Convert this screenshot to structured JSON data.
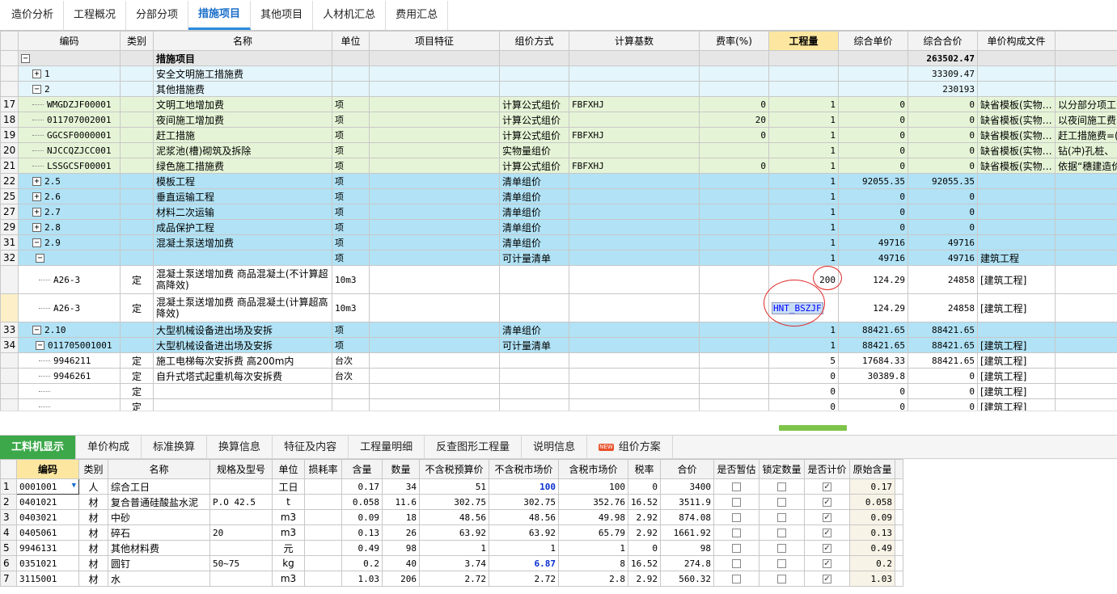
{
  "top_tabs": [
    "造价分析",
    "工程概况",
    "分部分项",
    "措施项目",
    "其他项目",
    "人材机汇总",
    "费用汇总"
  ],
  "grid": {
    "headers": [
      "",
      "编码",
      "类别",
      "名称",
      "单位",
      "项目特征",
      "组价方式",
      "计算基数",
      "费率(%)",
      "工程量",
      "综合单价",
      "综合合价",
      "单价构成文件"
    ],
    "rows": [
      {
        "seq": "",
        "tog": "−",
        "code": "",
        "type": "",
        "name": "措施项目",
        "unit": "",
        "feat": "",
        "method": "",
        "base": "",
        "rate": "",
        "qty": "",
        "uprice": "",
        "total": "263502.47",
        "file": "",
        "style": "gray",
        "indent": 0,
        "bold": true
      },
      {
        "seq": "",
        "tog": "+",
        "code": "1",
        "type": "",
        "name": "安全文明施工措施费",
        "unit": "",
        "feat": "",
        "method": "",
        "base": "",
        "rate": "",
        "qty": "",
        "uprice": "",
        "total": "33309.47",
        "file": "",
        "style": "lb",
        "indent": 1
      },
      {
        "seq": "",
        "tog": "−",
        "code": "2",
        "type": "",
        "name": "其他措施费",
        "unit": "",
        "feat": "",
        "method": "",
        "base": "",
        "rate": "",
        "qty": "",
        "uprice": "",
        "total": "230193",
        "file": "",
        "style": "lb",
        "indent": 1
      },
      {
        "seq": "17",
        "tog": "",
        "code": "WMGDZJF00001",
        "type": "",
        "name": "文明工地增加费",
        "unit": "项",
        "feat": "",
        "method": "计算公式组价",
        "base": "FBFXHJ",
        "rate": "0",
        "qty": "1",
        "uprice": "0",
        "total": "0",
        "file": "缺省模板(实物…",
        "extra": "以分部分项工",
        "style": "green",
        "indent": 2
      },
      {
        "seq": "18",
        "tog": "",
        "code": "011707002001",
        "type": "",
        "name": "夜间施工增加费",
        "unit": "项",
        "feat": "",
        "method": "计算公式组价",
        "base": "",
        "rate": "20",
        "qty": "1",
        "uprice": "0",
        "total": "0",
        "file": "缺省模板(实物…",
        "extra": "以夜间施工费",
        "style": "green",
        "indent": 2
      },
      {
        "seq": "19",
        "tog": "",
        "code": "GGCSF0000001",
        "type": "",
        "name": "赶工措施",
        "unit": "项",
        "feat": "",
        "method": "计算公式组价",
        "base": "FBFXHJ",
        "rate": "0",
        "qty": "1",
        "uprice": "0",
        "total": "0",
        "file": "缺省模板(实物…",
        "extra": "赶工措施费=(",
        "style": "green",
        "indent": 2
      },
      {
        "seq": "20",
        "tog": "",
        "code": "NJCCQZJCC001",
        "type": "",
        "name": "泥浆池(槽)砌筑及拆除",
        "unit": "项",
        "feat": "",
        "method": "实物量组价",
        "base": "",
        "rate": "",
        "qty": "1",
        "uprice": "0",
        "total": "0",
        "file": "缺省模板(实物…",
        "extra": "钻(冲)孔桩、",
        "style": "green",
        "indent": 2
      },
      {
        "seq": "21",
        "tog": "",
        "code": "LSSGCSF00001",
        "type": "",
        "name": "绿色施工措施费",
        "unit": "项",
        "feat": "",
        "method": "计算公式组价",
        "base": "FBFXHJ",
        "rate": "0",
        "qty": "1",
        "uprice": "0",
        "total": "0",
        "file": "缺省模板(实物…",
        "extra": "依据“穗建造价",
        "style": "green",
        "indent": 2
      },
      {
        "seq": "22",
        "tog": "+",
        "code": "2.5",
        "type": "",
        "name": "模板工程",
        "unit": "项",
        "feat": "",
        "method": "清单组价",
        "base": "",
        "rate": "",
        "qty": "1",
        "uprice": "92055.35",
        "total": "92055.35",
        "file": "",
        "style": "blue",
        "indent": 2
      },
      {
        "seq": "25",
        "tog": "+",
        "code": "2.6",
        "type": "",
        "name": "垂直运输工程",
        "unit": "项",
        "feat": "",
        "method": "清单组价",
        "base": "",
        "rate": "",
        "qty": "1",
        "uprice": "0",
        "total": "0",
        "file": "",
        "style": "blue",
        "indent": 2
      },
      {
        "seq": "27",
        "tog": "+",
        "code": "2.7",
        "type": "",
        "name": "材料二次运输",
        "unit": "项",
        "feat": "",
        "method": "清单组价",
        "base": "",
        "rate": "",
        "qty": "1",
        "uprice": "0",
        "total": "0",
        "file": "",
        "style": "blue",
        "indent": 2
      },
      {
        "seq": "29",
        "tog": "+",
        "code": "2.8",
        "type": "",
        "name": "成品保护工程",
        "unit": "项",
        "feat": "",
        "method": "清单组价",
        "base": "",
        "rate": "",
        "qty": "1",
        "uprice": "0",
        "total": "0",
        "file": "",
        "style": "blue",
        "indent": 2
      },
      {
        "seq": "31",
        "tog": "−",
        "code": "2.9",
        "type": "",
        "name": "混凝土泵送增加费",
        "unit": "项",
        "feat": "",
        "method": "清单组价",
        "base": "",
        "rate": "",
        "qty": "1",
        "uprice": "49716",
        "total": "49716",
        "file": "",
        "style": "blue",
        "indent": 2
      },
      {
        "seq": "32",
        "tog": "−",
        "code": "",
        "type": "",
        "name": "",
        "unit": "项",
        "feat": "",
        "method": "可计量清单",
        "base": "",
        "rate": "",
        "qty": "1",
        "uprice": "49716",
        "total": "49716",
        "file": "建筑工程",
        "style": "blue",
        "indent": 3
      },
      {
        "seq": "",
        "tog": "",
        "code": "A26-3",
        "type": "定",
        "name": "混凝土泵送增加费 商品混凝土(不计算超高降效)",
        "unit": "10m3",
        "feat": "",
        "method": "",
        "base": "",
        "rate": "",
        "qty": "200",
        "uprice": "124.29",
        "total": "24858",
        "file": "[建筑工程]",
        "style": "white",
        "indent": 4,
        "tall": true
      },
      {
        "seq": "",
        "tog": "",
        "code": "A26-3",
        "type": "定",
        "name": "混凝土泵送增加费 商品混凝土(计算超高降效)",
        "unit": "10m3",
        "feat": "",
        "method": "",
        "base": "",
        "rate": "",
        "qty": "HNT_BSZJF",
        "uprice": "124.29",
        "total": "24858",
        "file": "[建筑工程]",
        "style": "white",
        "indent": 4,
        "tall": true,
        "qtysel": true,
        "seqyellow": true
      },
      {
        "seq": "33",
        "tog": "−",
        "code": "2.10",
        "type": "",
        "name": "大型机械设备进出场及安拆",
        "unit": "项",
        "feat": "",
        "method": "清单组价",
        "base": "",
        "rate": "",
        "qty": "1",
        "uprice": "88421.65",
        "total": "88421.65",
        "file": "",
        "style": "blue",
        "indent": 2
      },
      {
        "seq": "34",
        "tog": "−",
        "code": "011705001001",
        "type": "",
        "name": "大型机械设备进出场及安拆",
        "unit": "项",
        "feat": "",
        "method": "可计量清单",
        "base": "",
        "rate": "",
        "qty": "1",
        "uprice": "88421.65",
        "total": "88421.65",
        "file": "[建筑工程]",
        "style": "blue",
        "indent": 3
      },
      {
        "seq": "",
        "tog": "",
        "code": "9946211",
        "type": "定",
        "name": "施工电梯每次安拆费 高200m内",
        "unit": "台次",
        "feat": "",
        "method": "",
        "base": "",
        "rate": "",
        "qty": "5",
        "uprice": "17684.33",
        "total": "88421.65",
        "file": "[建筑工程]",
        "style": "white",
        "indent": 4
      },
      {
        "seq": "",
        "tog": "",
        "code": "9946261",
        "type": "定",
        "name": "自升式塔式起重机每次安拆费",
        "unit": "台次",
        "feat": "",
        "method": "",
        "base": "",
        "rate": "",
        "qty": "0",
        "uprice": "30389.8",
        "total": "0",
        "file": "[建筑工程]",
        "style": "white",
        "indent": 4
      },
      {
        "seq": "",
        "tog": "",
        "code": "",
        "type": "定",
        "name": "",
        "unit": "",
        "feat": "",
        "method": "",
        "base": "",
        "rate": "",
        "qty": "0",
        "uprice": "0",
        "total": "0",
        "file": "[建筑工程]",
        "style": "white",
        "indent": 4
      },
      {
        "seq": "",
        "tog": "",
        "code": "",
        "type": "定",
        "name": "",
        "unit": "",
        "feat": "",
        "method": "",
        "base": "",
        "rate": "",
        "qty": "0",
        "uprice": "0",
        "total": "0",
        "file": "[建筑工程]",
        "style": "white",
        "indent": 4
      }
    ]
  },
  "bottom_tabs": [
    "工料机显示",
    "单价构成",
    "标准换算",
    "换算信息",
    "特征及内容",
    "工程量明细",
    "反查图形工程量",
    "说明信息",
    "组价方案"
  ],
  "new_badge": "NEW",
  "lower": {
    "headers": [
      "",
      "编码",
      "类别",
      "名称",
      "规格及型号",
      "单位",
      "损耗率",
      "含量",
      "数量",
      "不含税预算价",
      "不含税市场价",
      "含税市场价",
      "税率",
      "合价",
      "是否暂估",
      "锁定数量",
      "是否计价",
      "原始含量"
    ],
    "rows": [
      {
        "n": "1",
        "code": "0001001",
        "type": "人",
        "name": "综合工日",
        "spec": "",
        "unit": "工日",
        "loss": "",
        "content": "0.17",
        "qty": "34",
        "budget": "51",
        "market": "100",
        "taxmarket": "100",
        "tax": "0",
        "total": "3400",
        "est": false,
        "lock": false,
        "calc": true,
        "orig": "0.17",
        "marketblue": true,
        "dropdown": true
      },
      {
        "n": "2",
        "code": "0401021",
        "type": "材",
        "name": "复合普通硅酸盐水泥",
        "spec": "P.O 42.5",
        "unit": "t",
        "loss": "",
        "content": "0.058",
        "qty": "11.6",
        "budget": "302.75",
        "market": "302.75",
        "taxmarket": "352.76",
        "tax": "16.52",
        "total": "3511.9",
        "est": false,
        "lock": false,
        "calc": true,
        "orig": "0.058"
      },
      {
        "n": "3",
        "code": "0403021",
        "type": "材",
        "name": "中砂",
        "spec": "",
        "unit": "m3",
        "loss": "",
        "content": "0.09",
        "qty": "18",
        "budget": "48.56",
        "market": "48.56",
        "taxmarket": "49.98",
        "tax": "2.92",
        "total": "874.08",
        "est": false,
        "lock": false,
        "calc": true,
        "orig": "0.09"
      },
      {
        "n": "4",
        "code": "0405061",
        "type": "材",
        "name": "碎石",
        "spec": "20",
        "unit": "m3",
        "loss": "",
        "content": "0.13",
        "qty": "26",
        "budget": "63.92",
        "market": "63.92",
        "taxmarket": "65.79",
        "tax": "2.92",
        "total": "1661.92",
        "est": false,
        "lock": false,
        "calc": true,
        "orig": "0.13"
      },
      {
        "n": "5",
        "code": "9946131",
        "type": "材",
        "name": "其他材料费",
        "spec": "",
        "unit": "元",
        "loss": "",
        "content": "0.49",
        "qty": "98",
        "budget": "1",
        "market": "1",
        "taxmarket": "1",
        "tax": "0",
        "total": "98",
        "est": false,
        "lock": false,
        "calc": true,
        "orig": "0.49"
      },
      {
        "n": "6",
        "code": "0351021",
        "type": "材",
        "name": "圆钉",
        "spec": "50~75",
        "unit": "kg",
        "loss": "",
        "content": "0.2",
        "qty": "40",
        "budget": "3.74",
        "market": "6.87",
        "taxmarket": "8",
        "tax": "16.52",
        "total": "274.8",
        "est": false,
        "lock": false,
        "calc": true,
        "orig": "0.2",
        "marketblue": true
      },
      {
        "n": "7",
        "code": "3115001",
        "type": "材",
        "name": "水",
        "spec": "",
        "unit": "m3",
        "loss": "",
        "content": "1.03",
        "qty": "206",
        "budget": "2.72",
        "market": "2.72",
        "taxmarket": "2.8",
        "tax": "2.92",
        "total": "560.32",
        "est": false,
        "lock": false,
        "calc": true,
        "orig": "1.03"
      }
    ]
  },
  "colors": {
    "active_tab": "#1a6fc9",
    "green_tab": "#3ca84a",
    "row_blue": "#b1e2f5",
    "row_green": "#e5f4d6",
    "circle": "#e02a2a"
  }
}
